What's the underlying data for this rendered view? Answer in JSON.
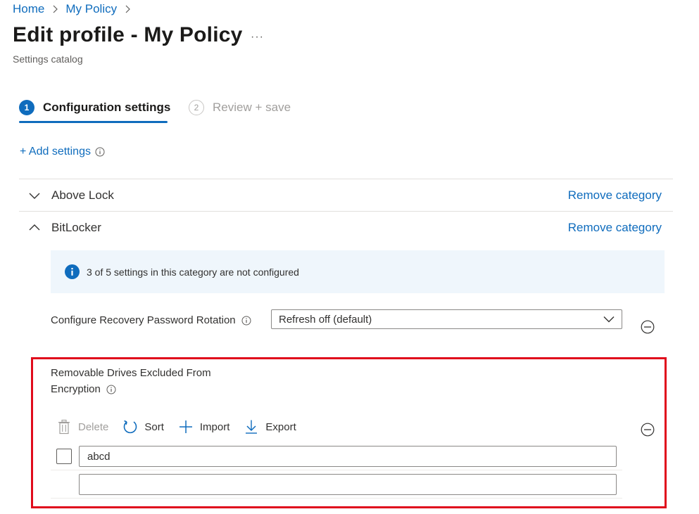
{
  "breadcrumb": {
    "items": [
      "Home",
      "My Policy"
    ]
  },
  "page": {
    "title": "Edit profile - My Policy",
    "more_label": "···",
    "subtitle": "Settings catalog"
  },
  "wizard": {
    "steps": [
      {
        "number": "1",
        "label": "Configuration settings",
        "active": true
      },
      {
        "number": "2",
        "label": "Review + save",
        "active": false
      }
    ]
  },
  "add_settings": {
    "label": "+ Add settings"
  },
  "categories": [
    {
      "name": "Above Lock",
      "expanded": false,
      "remove_label": "Remove category"
    },
    {
      "name": "BitLocker",
      "expanded": true,
      "remove_label": "Remove category"
    }
  ],
  "notice": {
    "text": "3 of 5 settings in this category are not configured"
  },
  "settings": {
    "recovery": {
      "label": "Configure Recovery Password Rotation",
      "value": "Refresh off (default)"
    },
    "removable": {
      "label_line1": "Removable Drives Excluded From",
      "label_line2": "Encryption",
      "toolbar": {
        "delete": "Delete",
        "sort": "Sort",
        "import": "Import",
        "export": "Export"
      },
      "rows": [
        {
          "value": "abcd"
        },
        {
          "value": ""
        }
      ]
    }
  },
  "colors": {
    "accent": "#0f6cbd",
    "highlight_border": "#e00b1c",
    "notice_bg": "#eff6fc"
  }
}
